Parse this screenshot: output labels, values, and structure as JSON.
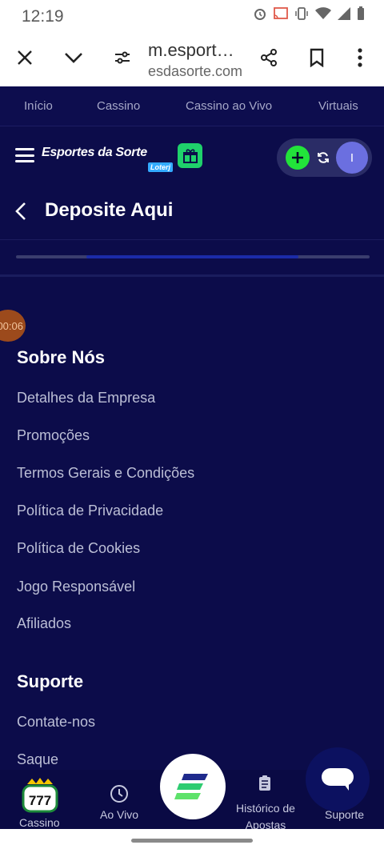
{
  "status_bar": {
    "time": "12:19"
  },
  "browser": {
    "url_main": "m.esport…",
    "url_sub": "esdasorte.com",
    "icons": [
      "close-icon",
      "chevron-down-icon",
      "site-settings-icon",
      "share-icon",
      "bookmark-icon",
      "more-icon"
    ]
  },
  "top_nav": {
    "items": [
      "Início",
      "Cassino",
      "Cassino ao Vivo",
      "Virtuais"
    ]
  },
  "header": {
    "logo_text": "Esportes da Sorte",
    "logo_sub": "Loterj",
    "avatar_initial": "I",
    "accent_green": "#22e33a"
  },
  "deposit": {
    "title": "Deposite Aqui",
    "progress": 0.6
  },
  "timer_badge": "00:06",
  "about": {
    "title": "Sobre Nós",
    "links": [
      "Detalhes da Empresa",
      "Promoções",
      "Termos Gerais e Condições",
      "Política de Privacidade",
      "Política de Cookies",
      "Jogo Responsável",
      "Afiliados"
    ]
  },
  "support": {
    "title": "Suporte",
    "links": [
      "Contate-nos",
      "Saque"
    ]
  },
  "bottom_nav": {
    "cassino": "Cassino",
    "ao_vivo": "Ao Vivo",
    "historico": "Histórico de Apostas",
    "suporte": "Suporte"
  }
}
